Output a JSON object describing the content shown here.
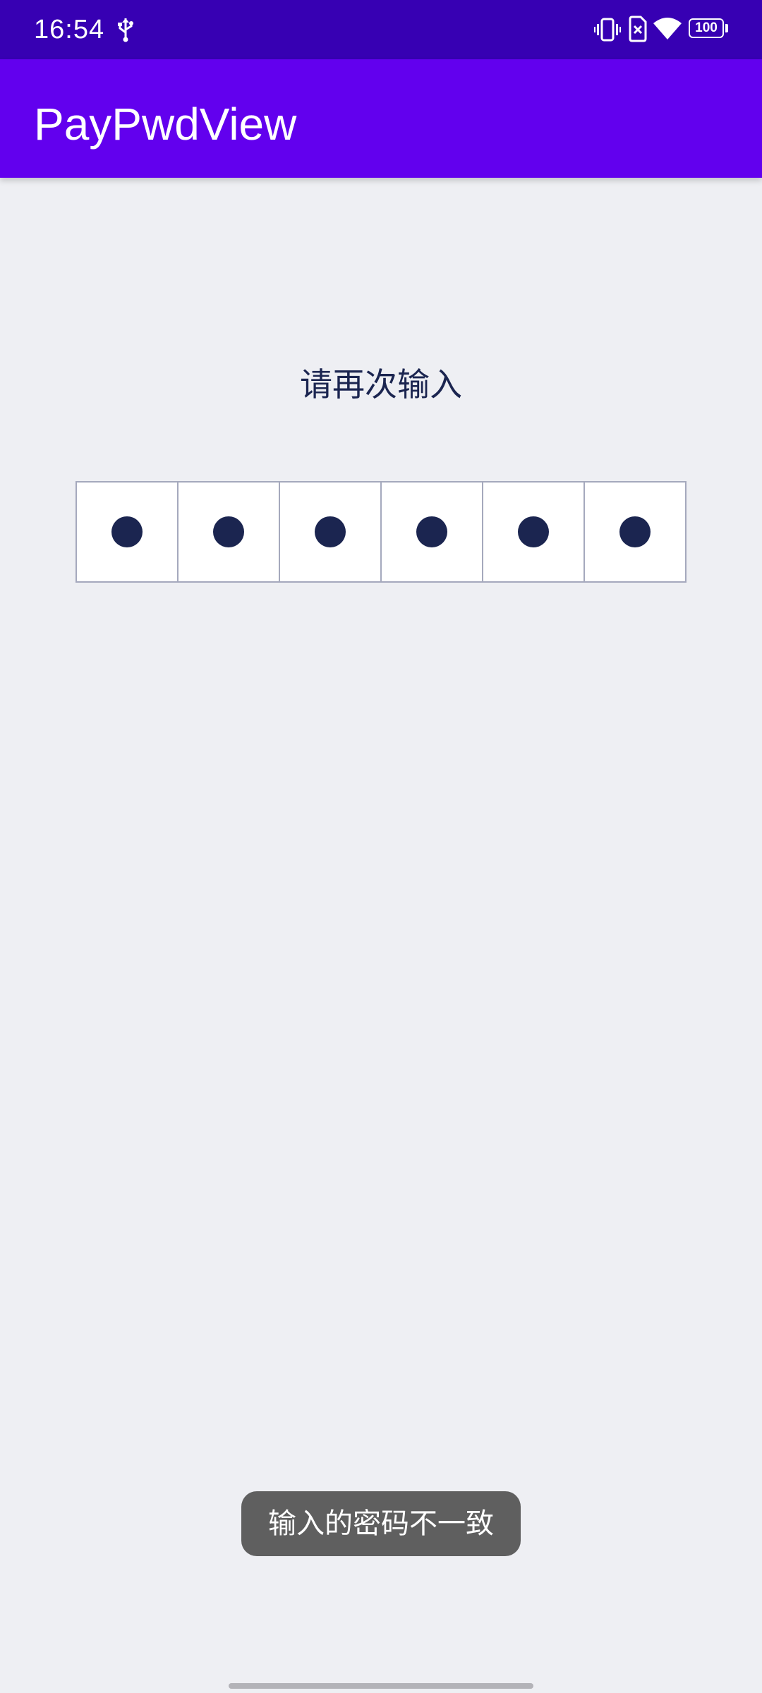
{
  "status_bar": {
    "time": "16:54",
    "battery_level": "100",
    "icons": [
      "usb-icon",
      "vibrate-icon",
      "no-sim-icon",
      "wifi-icon",
      "battery-icon"
    ]
  },
  "app_bar": {
    "title": "PayPwdView"
  },
  "main": {
    "prompt": "请再次输入",
    "password_length": 6,
    "filled_count": 6
  },
  "toast": {
    "message": "输入的密码不一致"
  },
  "colors": {
    "status_bar": "#3700b3",
    "app_bar": "#6200ee",
    "background": "#eeeff3",
    "dot": "#1b2550",
    "cell_border": "#a5a9bd",
    "toast_bg": "#5f5f5f"
  }
}
